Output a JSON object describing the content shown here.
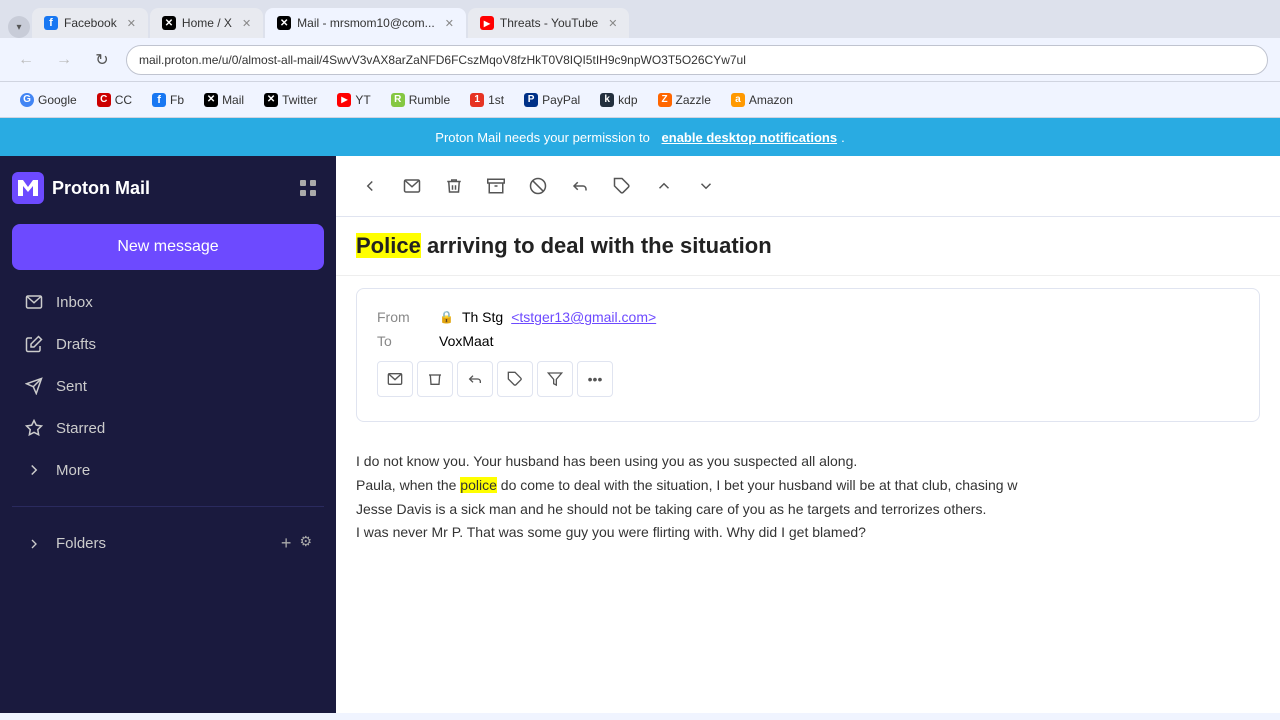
{
  "browser": {
    "tabs": [
      {
        "id": "facebook",
        "label": "Facebook",
        "favicon": "fb",
        "active": false
      },
      {
        "id": "twitter",
        "label": "Home / X",
        "favicon": "x",
        "active": false
      },
      {
        "id": "mail",
        "label": "Mail - mrsmom10@com...",
        "favicon": "x",
        "active": true
      },
      {
        "id": "youtube",
        "label": "Threats - YouTube",
        "favicon": "yt",
        "active": false
      }
    ],
    "url": "mail.proton.me/u/0/almost-all-mail/4SwvV3vAX8arZaNFD6FCszMqoV8fzHkT0V8IQI5tIH9c9npWO3T5O26CYw7ul",
    "bookmarks": [
      {
        "id": "google",
        "label": "Google",
        "color": "#4285f4"
      },
      {
        "id": "cc",
        "label": "CC",
        "color": "#cc0000"
      },
      {
        "id": "fb",
        "label": "Fb",
        "color": "#1877f2"
      },
      {
        "id": "mail",
        "label": "Mail",
        "color": "#000000"
      },
      {
        "id": "twitter",
        "label": "Twitter",
        "color": "#000000"
      },
      {
        "id": "yt",
        "label": "YT",
        "color": "#ff0000"
      },
      {
        "id": "rumble",
        "label": "Rumble",
        "color": "#85c742"
      },
      {
        "id": "1st",
        "label": "1st",
        "color": "#e63323"
      },
      {
        "id": "paypal",
        "label": "PayPal",
        "color": "#003087"
      },
      {
        "id": "kdp",
        "label": "kdp",
        "color": "#232f3e"
      },
      {
        "id": "zazzle",
        "label": "Zazzle",
        "color": "#ff6600"
      },
      {
        "id": "amazon",
        "label": "Amazon",
        "color": "#ff9900"
      }
    ]
  },
  "notification": {
    "text": "Proton Mail needs your permission to",
    "link_text": "enable desktop notifications",
    "suffix": "."
  },
  "sidebar": {
    "logo_text": "Proton Mail",
    "new_message_label": "New message",
    "nav_items": [
      {
        "id": "inbox",
        "label": "Inbox",
        "icon": "inbox"
      },
      {
        "id": "drafts",
        "label": "Drafts",
        "icon": "drafts"
      },
      {
        "id": "sent",
        "label": "Sent",
        "icon": "sent"
      },
      {
        "id": "starred",
        "label": "Starred",
        "icon": "star"
      },
      {
        "id": "more",
        "label": "More",
        "icon": "more",
        "has_chevron": true
      }
    ],
    "folders_label": "Folders",
    "folders_add_label": "+",
    "folders_settings_label": "⚙"
  },
  "email": {
    "toolbar_buttons": [
      "back",
      "move",
      "delete",
      "archive",
      "spam",
      "reply",
      "label",
      "up",
      "down"
    ],
    "subject": "Police arriving to deal with the situation",
    "subject_highlight": "Police",
    "from_name": "Th Stg",
    "from_email": "tstger13@gmail.com",
    "to": "VoxMaat",
    "body_lines": [
      "I do not know you. Your husband has been using you as you suspected all along.",
      "Paula, when the police do come to deal with the situation, I bet your husband will be at that club, chasing w",
      "Jesse Davis is a sick man and he should not be taking care of you as he targets and terrorizes others.",
      "I was never Mr P. That was some guy you were flirting with. Why did I get blamed?"
    ],
    "body_highlight_word": "police"
  }
}
